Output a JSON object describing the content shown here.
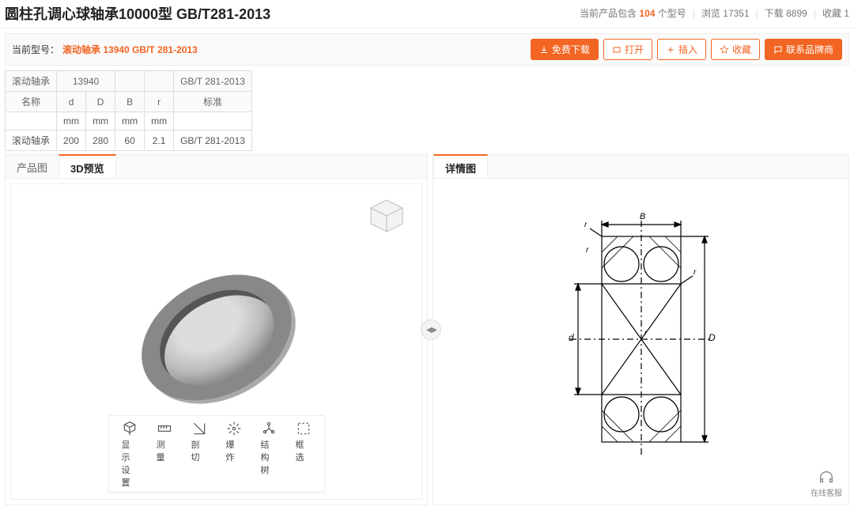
{
  "header": {
    "title": "圆柱孔调心球轴承10000型 GB/T281-2013",
    "stats": {
      "contains_prefix": "当前产品包含",
      "contains_count": "104",
      "contains_suffix": "个型号",
      "views_label": "浏览",
      "views_count": "17351",
      "downloads_label": "下载",
      "downloads_count": "8899",
      "favs_label": "收藏",
      "favs_count": "1"
    }
  },
  "modelbar": {
    "label": "当前型号：",
    "model": "滚动轴承 13940 GB/T 281-2013",
    "buttons": {
      "download": "免费下载",
      "open": "打开",
      "insert": "插入",
      "fav": "收藏",
      "contact": "联系品牌商"
    }
  },
  "param_table": {
    "row0": [
      "滚动轴承",
      "",
      "13940",
      "",
      "",
      "GB/T 281-2013"
    ],
    "row1": [
      "名称",
      "d",
      "D",
      "B",
      "r",
      "标准"
    ],
    "row2": [
      "",
      "mm",
      "mm",
      "mm",
      "mm",
      ""
    ],
    "row3": [
      "滚动轴承",
      "200",
      "280",
      "60",
      "2.1",
      "GB/T 281-2013"
    ]
  },
  "tabs_left": {
    "product_img": "产品图",
    "preview_3d": "3D预览"
  },
  "tabs_right": {
    "detail": "详情图"
  },
  "toolbar3d": {
    "display": "显示设置",
    "measure": "测量",
    "section": "剖切",
    "explode": "爆炸",
    "tree": "结构树",
    "boxselect": "框选"
  },
  "float_cs": "在线客服"
}
